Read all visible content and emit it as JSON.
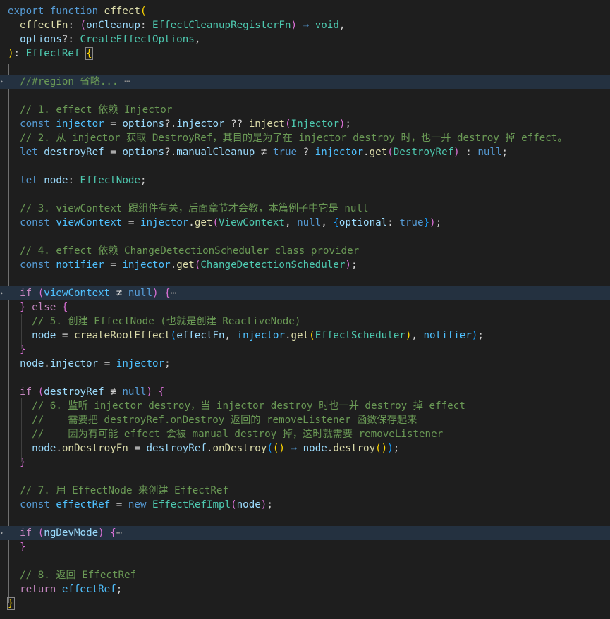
{
  "editor": {
    "lines": [
      {
        "hl": false,
        "fold": "",
        "tokens": [
          [
            "kw",
            "export"
          ],
          [
            "op",
            " "
          ],
          [
            "kw",
            "function"
          ],
          [
            "op",
            " "
          ],
          [
            "fn",
            "effect"
          ],
          [
            "b1",
            "("
          ]
        ]
      },
      {
        "hl": false,
        "fold": "",
        "tokens": [
          [
            "op",
            "  "
          ],
          [
            "fn",
            "effectFn"
          ],
          [
            "op",
            ": "
          ],
          [
            "b2",
            "("
          ],
          [
            "var",
            "onCleanup"
          ],
          [
            "op",
            ": "
          ],
          [
            "type",
            "EffectCleanupRegisterFn"
          ],
          [
            "b2",
            ")"
          ],
          [
            "op",
            " "
          ],
          [
            "kw",
            "⇒"
          ],
          [
            "op",
            " "
          ],
          [
            "type",
            "void"
          ],
          [
            "op",
            ","
          ]
        ]
      },
      {
        "hl": false,
        "fold": "",
        "tokens": [
          [
            "op",
            "  "
          ],
          [
            "var",
            "options"
          ],
          [
            "op",
            "?: "
          ],
          [
            "type",
            "CreateEffectOptions"
          ],
          [
            "op",
            ","
          ]
        ]
      },
      {
        "hl": false,
        "fold": "",
        "tokens": [
          [
            "b1",
            ")"
          ],
          [
            "op",
            ": "
          ],
          [
            "type",
            "EffectRef"
          ],
          [
            "op",
            " "
          ],
          [
            "b1box",
            "{"
          ]
        ]
      },
      {
        "hl": false,
        "fold": "",
        "tokens": []
      },
      {
        "hl": true,
        "fold": "›",
        "tokens": [
          [
            "op",
            "  "
          ],
          [
            "cmt",
            "//#region 省略..."
          ],
          [
            "op",
            " "
          ],
          [
            "dots",
            "⋯"
          ]
        ]
      },
      {
        "hl": false,
        "fold": "",
        "tokens": []
      },
      {
        "hl": false,
        "fold": "",
        "tokens": [
          [
            "op",
            "  "
          ],
          [
            "cmt",
            "// 1. effect 依赖 Injector"
          ]
        ]
      },
      {
        "hl": false,
        "fold": "",
        "tokens": [
          [
            "op",
            "  "
          ],
          [
            "kw",
            "const"
          ],
          [
            "op",
            " "
          ],
          [
            "const",
            "injector"
          ],
          [
            "op",
            " = "
          ],
          [
            "var",
            "options"
          ],
          [
            "op",
            "?."
          ],
          [
            "var",
            "injector"
          ],
          [
            "op",
            " ?? "
          ],
          [
            "fn",
            "inject"
          ],
          [
            "b2",
            "("
          ],
          [
            "type",
            "Injector"
          ],
          [
            "b2",
            ")"
          ],
          [
            "op",
            ";"
          ]
        ]
      },
      {
        "hl": false,
        "fold": "",
        "tokens": [
          [
            "op",
            "  "
          ],
          [
            "cmt",
            "// 2. 从 injector 获取 DestroyRef，其目的是为了在 injector destroy 时，也一并 destroy 掉 effect。"
          ]
        ]
      },
      {
        "hl": false,
        "fold": "",
        "tokens": [
          [
            "op",
            "  "
          ],
          [
            "kw",
            "let"
          ],
          [
            "op",
            " "
          ],
          [
            "var",
            "destroyRef"
          ],
          [
            "op",
            " = "
          ],
          [
            "var",
            "options"
          ],
          [
            "op",
            "?."
          ],
          [
            "var",
            "manualCleanup"
          ],
          [
            "op",
            " ≢ "
          ],
          [
            "kw",
            "true"
          ],
          [
            "op",
            " ? "
          ],
          [
            "const",
            "injector"
          ],
          [
            "op",
            "."
          ],
          [
            "fn",
            "get"
          ],
          [
            "b2",
            "("
          ],
          [
            "type",
            "DestroyRef"
          ],
          [
            "b2",
            ")"
          ],
          [
            "op",
            " : "
          ],
          [
            "kw",
            "null"
          ],
          [
            "op",
            ";"
          ]
        ]
      },
      {
        "hl": false,
        "fold": "",
        "tokens": []
      },
      {
        "hl": false,
        "fold": "",
        "tokens": [
          [
            "op",
            "  "
          ],
          [
            "kw",
            "let"
          ],
          [
            "op",
            " "
          ],
          [
            "var",
            "node"
          ],
          [
            "op",
            ": "
          ],
          [
            "type",
            "EffectNode"
          ],
          [
            "op",
            ";"
          ]
        ]
      },
      {
        "hl": false,
        "fold": "",
        "tokens": []
      },
      {
        "hl": false,
        "fold": "",
        "tokens": [
          [
            "op",
            "  "
          ],
          [
            "cmt",
            "// 3. viewContext 跟组件有关，后面章节才会教，本篇例子中它是 null"
          ]
        ]
      },
      {
        "hl": false,
        "fold": "",
        "tokens": [
          [
            "op",
            "  "
          ],
          [
            "kw",
            "const"
          ],
          [
            "op",
            " "
          ],
          [
            "const",
            "viewContext"
          ],
          [
            "op",
            " = "
          ],
          [
            "const",
            "injector"
          ],
          [
            "op",
            "."
          ],
          [
            "fn",
            "get"
          ],
          [
            "b2",
            "("
          ],
          [
            "type",
            "ViewContext"
          ],
          [
            "op",
            ", "
          ],
          [
            "kw",
            "null"
          ],
          [
            "op",
            ", "
          ],
          [
            "b3",
            "{"
          ],
          [
            "var",
            "optional"
          ],
          [
            "op",
            ": "
          ],
          [
            "kw",
            "true"
          ],
          [
            "b3",
            "}"
          ],
          [
            "b2",
            ")"
          ],
          [
            "op",
            ";"
          ]
        ]
      },
      {
        "hl": false,
        "fold": "",
        "tokens": []
      },
      {
        "hl": false,
        "fold": "",
        "tokens": [
          [
            "op",
            "  "
          ],
          [
            "cmt",
            "// 4. effect 依赖 ChangeDetectionScheduler class provider"
          ]
        ]
      },
      {
        "hl": false,
        "fold": "",
        "tokens": [
          [
            "op",
            "  "
          ],
          [
            "kw",
            "const"
          ],
          [
            "op",
            " "
          ],
          [
            "const",
            "notifier"
          ],
          [
            "op",
            " = "
          ],
          [
            "const",
            "injector"
          ],
          [
            "op",
            "."
          ],
          [
            "fn",
            "get"
          ],
          [
            "b2",
            "("
          ],
          [
            "type",
            "ChangeDetectionScheduler"
          ],
          [
            "b2",
            ")"
          ],
          [
            "op",
            ";"
          ]
        ]
      },
      {
        "hl": false,
        "fold": "",
        "tokens": []
      },
      {
        "hl": true,
        "fold": "›",
        "tokens": [
          [
            "op",
            "  "
          ],
          [
            "ctl",
            "if"
          ],
          [
            "op",
            " "
          ],
          [
            "b2",
            "("
          ],
          [
            "const",
            "viewContext"
          ],
          [
            "op",
            " ≢ "
          ],
          [
            "kw",
            "null"
          ],
          [
            "b2",
            ")"
          ],
          [
            "op",
            " "
          ],
          [
            "b2",
            "{"
          ],
          [
            "dots",
            "⋯"
          ]
        ]
      },
      {
        "hl": false,
        "fold": "",
        "tokens": [
          [
            "op",
            "  "
          ],
          [
            "b2",
            "}"
          ],
          [
            "op",
            " "
          ],
          [
            "ctl",
            "else"
          ],
          [
            "op",
            " "
          ],
          [
            "b2",
            "{"
          ]
        ]
      },
      {
        "hl": false,
        "fold": "",
        "tokens": [
          [
            "op",
            "    "
          ],
          [
            "cmt",
            "// 5. 创建 EffectNode (也就是创建 ReactiveNode)"
          ]
        ]
      },
      {
        "hl": false,
        "fold": "",
        "tokens": [
          [
            "op",
            "    "
          ],
          [
            "var",
            "node"
          ],
          [
            "op",
            " = "
          ],
          [
            "fn",
            "createRootEffect"
          ],
          [
            "b3",
            "("
          ],
          [
            "var",
            "effectFn"
          ],
          [
            "op",
            ", "
          ],
          [
            "const",
            "injector"
          ],
          [
            "op",
            "."
          ],
          [
            "fn",
            "get"
          ],
          [
            "b1",
            "("
          ],
          [
            "type",
            "EffectScheduler"
          ],
          [
            "b1",
            ")"
          ],
          [
            "op",
            ", "
          ],
          [
            "const",
            "notifier"
          ],
          [
            "b3",
            ")"
          ],
          [
            "op",
            ";"
          ]
        ]
      },
      {
        "hl": false,
        "fold": "",
        "tokens": [
          [
            "op",
            "  "
          ],
          [
            "b2",
            "}"
          ]
        ]
      },
      {
        "hl": false,
        "fold": "",
        "tokens": [
          [
            "op",
            "  "
          ],
          [
            "var",
            "node"
          ],
          [
            "op",
            "."
          ],
          [
            "var",
            "injector"
          ],
          [
            "op",
            " = "
          ],
          [
            "const",
            "injector"
          ],
          [
            "op",
            ";"
          ]
        ]
      },
      {
        "hl": false,
        "fold": "",
        "tokens": []
      },
      {
        "hl": false,
        "fold": "",
        "tokens": [
          [
            "op",
            "  "
          ],
          [
            "ctl",
            "if"
          ],
          [
            "op",
            " "
          ],
          [
            "b2",
            "("
          ],
          [
            "var",
            "destroyRef"
          ],
          [
            "op",
            " ≢ "
          ],
          [
            "kw",
            "null"
          ],
          [
            "b2",
            ")"
          ],
          [
            "op",
            " "
          ],
          [
            "b2",
            "{"
          ]
        ]
      },
      {
        "hl": false,
        "fold": "",
        "tokens": [
          [
            "op",
            "    "
          ],
          [
            "cmt",
            "// 6. 监听 injector destroy，当 injector destroy 时也一并 destroy 掉 effect"
          ]
        ]
      },
      {
        "hl": false,
        "fold": "",
        "tokens": [
          [
            "op",
            "    "
          ],
          [
            "cmt",
            "//    需要把 destroyRef.onDestroy 返回的 removeListener 函数保存起来"
          ]
        ]
      },
      {
        "hl": false,
        "fold": "",
        "tokens": [
          [
            "op",
            "    "
          ],
          [
            "cmt",
            "//    因为有可能 effect 会被 manual destroy 掉，这时就需要 removeListener"
          ]
        ]
      },
      {
        "hl": false,
        "fold": "",
        "tokens": [
          [
            "op",
            "    "
          ],
          [
            "var",
            "node"
          ],
          [
            "op",
            "."
          ],
          [
            "fn",
            "onDestroyFn"
          ],
          [
            "op",
            " = "
          ],
          [
            "var",
            "destroyRef"
          ],
          [
            "op",
            "."
          ],
          [
            "fn",
            "onDestroy"
          ],
          [
            "b3",
            "("
          ],
          [
            "b1",
            "()"
          ],
          [
            "op",
            " "
          ],
          [
            "kw",
            "⇒"
          ],
          [
            "op",
            " "
          ],
          [
            "var",
            "node"
          ],
          [
            "op",
            "."
          ],
          [
            "fn",
            "destroy"
          ],
          [
            "b1",
            "()"
          ],
          [
            "b3",
            ")"
          ],
          [
            "op",
            ";"
          ]
        ]
      },
      {
        "hl": false,
        "fold": "",
        "tokens": [
          [
            "op",
            "  "
          ],
          [
            "b2",
            "}"
          ]
        ]
      },
      {
        "hl": false,
        "fold": "",
        "tokens": []
      },
      {
        "hl": false,
        "fold": "",
        "tokens": [
          [
            "op",
            "  "
          ],
          [
            "cmt",
            "// 7. 用 EffectNode 来创建 EffectRef"
          ]
        ]
      },
      {
        "hl": false,
        "fold": "",
        "tokens": [
          [
            "op",
            "  "
          ],
          [
            "kw",
            "const"
          ],
          [
            "op",
            " "
          ],
          [
            "const",
            "effectRef"
          ],
          [
            "op",
            " = "
          ],
          [
            "kw",
            "new"
          ],
          [
            "op",
            " "
          ],
          [
            "type",
            "EffectRefImpl"
          ],
          [
            "b2",
            "("
          ],
          [
            "var",
            "node"
          ],
          [
            "b2",
            ")"
          ],
          [
            "op",
            ";"
          ]
        ]
      },
      {
        "hl": false,
        "fold": "",
        "tokens": []
      },
      {
        "hl": true,
        "fold": "›",
        "tokens": [
          [
            "op",
            "  "
          ],
          [
            "ctl",
            "if"
          ],
          [
            "op",
            " "
          ],
          [
            "b2",
            "("
          ],
          [
            "var",
            "ngDevMode"
          ],
          [
            "b2",
            ")"
          ],
          [
            "op",
            " "
          ],
          [
            "b2",
            "{"
          ],
          [
            "dots",
            "⋯"
          ]
        ]
      },
      {
        "hl": false,
        "fold": "",
        "tokens": [
          [
            "op",
            "  "
          ],
          [
            "b2",
            "}"
          ]
        ]
      },
      {
        "hl": false,
        "fold": "",
        "tokens": []
      },
      {
        "hl": false,
        "fold": "",
        "tokens": [
          [
            "op",
            "  "
          ],
          [
            "cmt",
            "// 8. 返回 EffectRef"
          ]
        ]
      },
      {
        "hl": false,
        "fold": "",
        "tokens": [
          [
            "op",
            "  "
          ],
          [
            "ctl",
            "return"
          ],
          [
            "op",
            " "
          ],
          [
            "const",
            "effectRef"
          ],
          [
            "op",
            ";"
          ]
        ]
      },
      {
        "hl": false,
        "fold": "",
        "tokens": [
          [
            "b1box",
            "}"
          ]
        ]
      }
    ]
  }
}
